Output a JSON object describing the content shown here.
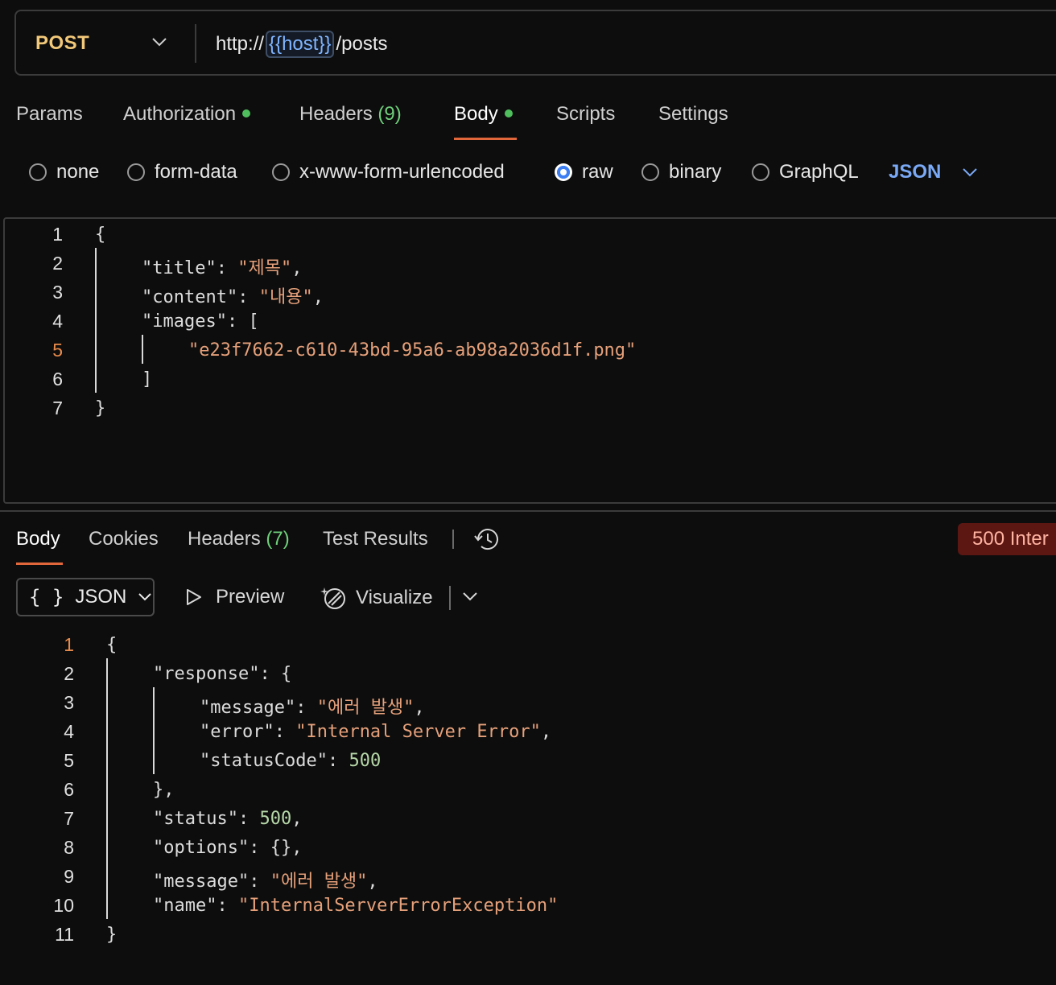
{
  "request": {
    "method": "POST",
    "url_prefix": "http://",
    "url_variable": "{{host}}",
    "url_suffix": "/posts"
  },
  "request_tabs": [
    {
      "label": "Params"
    },
    {
      "label": "Authorization"
    },
    {
      "label": "Headers",
      "count": "(9)"
    },
    {
      "label": "Body"
    },
    {
      "label": "Scripts"
    },
    {
      "label": "Settings"
    }
  ],
  "body_types": {
    "options": [
      "none",
      "form-data",
      "x-www-form-urlencoded",
      "raw",
      "binary",
      "GraphQL"
    ],
    "selected": "raw",
    "format": "JSON"
  },
  "request_body": {
    "line_numbers": [
      "1",
      "2",
      "3",
      "4",
      "5",
      "6",
      "7"
    ],
    "current_line": "5",
    "title_key": "\"title\"",
    "title_value": "\"제목\"",
    "content_key": "\"content\"",
    "content_value": "\"내용\"",
    "images_key": "\"images\"",
    "image_value": "\"e23f7662-c610-43bd-95a6-ab98a2036d1f.png\""
  },
  "response_tabs": [
    {
      "label": "Body"
    },
    {
      "label": "Cookies"
    },
    {
      "label": "Headers",
      "count": "(7)"
    },
    {
      "label": "Test Results"
    }
  ],
  "response_status": "500 Inter",
  "response_toolbar": {
    "format": "JSON",
    "preview": "Preview",
    "visualize": "Visualize"
  },
  "response_body": {
    "line_numbers": [
      "1",
      "2",
      "3",
      "4",
      "5",
      "6",
      "7",
      "8",
      "9",
      "10",
      "11"
    ],
    "current_line": "1",
    "response_key": "\"response\"",
    "message_key": "\"message\"",
    "message_value": "\"에러 발생\"",
    "error_key": "\"error\"",
    "error_value": "\"Internal Server Error\"",
    "statusCode_key": "\"statusCode\"",
    "statusCode_value": "500",
    "status_key": "\"status\"",
    "status_value": "500",
    "options_key": "\"options\"",
    "message2_key": "\"message\"",
    "message2_value": "\"에러 발생\"",
    "name_key": "\"name\"",
    "name_value": "\"InternalServerErrorException\""
  },
  "colors": {
    "method": "#f2c879",
    "accent_underline": "#e2683b",
    "variable": "#7fb4ff",
    "string": "#e5a07a",
    "number": "#b6d7a8",
    "status_badge_bg": "#5c1713"
  }
}
